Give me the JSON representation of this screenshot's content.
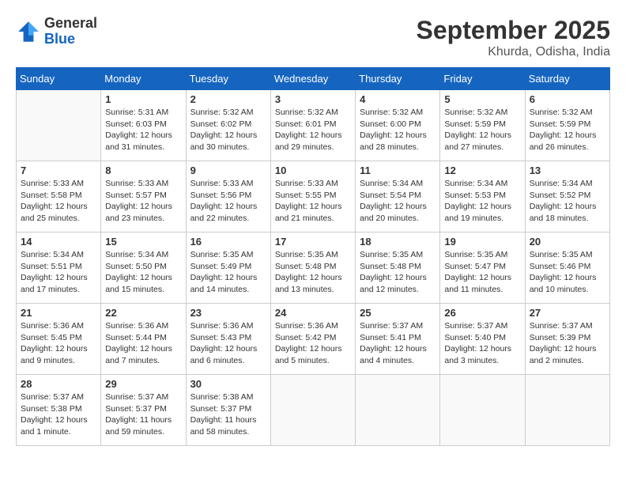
{
  "header": {
    "logo_general": "General",
    "logo_blue": "Blue",
    "month_title": "September 2025",
    "location": "Khurda, Odisha, India"
  },
  "days_of_week": [
    "Sunday",
    "Monday",
    "Tuesday",
    "Wednesday",
    "Thursday",
    "Friday",
    "Saturday"
  ],
  "weeks": [
    [
      {
        "day": "",
        "info": ""
      },
      {
        "day": "1",
        "info": "Sunrise: 5:31 AM\nSunset: 6:03 PM\nDaylight: 12 hours\nand 31 minutes."
      },
      {
        "day": "2",
        "info": "Sunrise: 5:32 AM\nSunset: 6:02 PM\nDaylight: 12 hours\nand 30 minutes."
      },
      {
        "day": "3",
        "info": "Sunrise: 5:32 AM\nSunset: 6:01 PM\nDaylight: 12 hours\nand 29 minutes."
      },
      {
        "day": "4",
        "info": "Sunrise: 5:32 AM\nSunset: 6:00 PM\nDaylight: 12 hours\nand 28 minutes."
      },
      {
        "day": "5",
        "info": "Sunrise: 5:32 AM\nSunset: 5:59 PM\nDaylight: 12 hours\nand 27 minutes."
      },
      {
        "day": "6",
        "info": "Sunrise: 5:32 AM\nSunset: 5:59 PM\nDaylight: 12 hours\nand 26 minutes."
      }
    ],
    [
      {
        "day": "7",
        "info": "Sunrise: 5:33 AM\nSunset: 5:58 PM\nDaylight: 12 hours\nand 25 minutes."
      },
      {
        "day": "8",
        "info": "Sunrise: 5:33 AM\nSunset: 5:57 PM\nDaylight: 12 hours\nand 23 minutes."
      },
      {
        "day": "9",
        "info": "Sunrise: 5:33 AM\nSunset: 5:56 PM\nDaylight: 12 hours\nand 22 minutes."
      },
      {
        "day": "10",
        "info": "Sunrise: 5:33 AM\nSunset: 5:55 PM\nDaylight: 12 hours\nand 21 minutes."
      },
      {
        "day": "11",
        "info": "Sunrise: 5:34 AM\nSunset: 5:54 PM\nDaylight: 12 hours\nand 20 minutes."
      },
      {
        "day": "12",
        "info": "Sunrise: 5:34 AM\nSunset: 5:53 PM\nDaylight: 12 hours\nand 19 minutes."
      },
      {
        "day": "13",
        "info": "Sunrise: 5:34 AM\nSunset: 5:52 PM\nDaylight: 12 hours\nand 18 minutes."
      }
    ],
    [
      {
        "day": "14",
        "info": "Sunrise: 5:34 AM\nSunset: 5:51 PM\nDaylight: 12 hours\nand 17 minutes."
      },
      {
        "day": "15",
        "info": "Sunrise: 5:34 AM\nSunset: 5:50 PM\nDaylight: 12 hours\nand 15 minutes."
      },
      {
        "day": "16",
        "info": "Sunrise: 5:35 AM\nSunset: 5:49 PM\nDaylight: 12 hours\nand 14 minutes."
      },
      {
        "day": "17",
        "info": "Sunrise: 5:35 AM\nSunset: 5:48 PM\nDaylight: 12 hours\nand 13 minutes."
      },
      {
        "day": "18",
        "info": "Sunrise: 5:35 AM\nSunset: 5:48 PM\nDaylight: 12 hours\nand 12 minutes."
      },
      {
        "day": "19",
        "info": "Sunrise: 5:35 AM\nSunset: 5:47 PM\nDaylight: 12 hours\nand 11 minutes."
      },
      {
        "day": "20",
        "info": "Sunrise: 5:35 AM\nSunset: 5:46 PM\nDaylight: 12 hours\nand 10 minutes."
      }
    ],
    [
      {
        "day": "21",
        "info": "Sunrise: 5:36 AM\nSunset: 5:45 PM\nDaylight: 12 hours\nand 9 minutes."
      },
      {
        "day": "22",
        "info": "Sunrise: 5:36 AM\nSunset: 5:44 PM\nDaylight: 12 hours\nand 7 minutes."
      },
      {
        "day": "23",
        "info": "Sunrise: 5:36 AM\nSunset: 5:43 PM\nDaylight: 12 hours\nand 6 minutes."
      },
      {
        "day": "24",
        "info": "Sunrise: 5:36 AM\nSunset: 5:42 PM\nDaylight: 12 hours\nand 5 minutes."
      },
      {
        "day": "25",
        "info": "Sunrise: 5:37 AM\nSunset: 5:41 PM\nDaylight: 12 hours\nand 4 minutes."
      },
      {
        "day": "26",
        "info": "Sunrise: 5:37 AM\nSunset: 5:40 PM\nDaylight: 12 hours\nand 3 minutes."
      },
      {
        "day": "27",
        "info": "Sunrise: 5:37 AM\nSunset: 5:39 PM\nDaylight: 12 hours\nand 2 minutes."
      }
    ],
    [
      {
        "day": "28",
        "info": "Sunrise: 5:37 AM\nSunset: 5:38 PM\nDaylight: 12 hours\nand 1 minute."
      },
      {
        "day": "29",
        "info": "Sunrise: 5:37 AM\nSunset: 5:37 PM\nDaylight: 11 hours\nand 59 minutes."
      },
      {
        "day": "30",
        "info": "Sunrise: 5:38 AM\nSunset: 5:37 PM\nDaylight: 11 hours\nand 58 minutes."
      },
      {
        "day": "",
        "info": ""
      },
      {
        "day": "",
        "info": ""
      },
      {
        "day": "",
        "info": ""
      },
      {
        "day": "",
        "info": ""
      }
    ]
  ]
}
